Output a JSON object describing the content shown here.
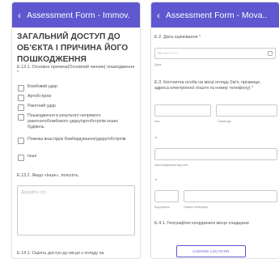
{
  "left_screen": {
    "title": "Assessment Form - Immov.",
    "heading": "ЗАГАЛЬНИЙ ДОСТУП ДО ОБ'ЄКТА І ПРИЧИНА ЙОГО ПОШКОДЖЕННЯ",
    "question_e131": "Е.13.1. Основна причина(Основний чинник) пошкодження *",
    "options": [
      "Бомбовий удар",
      "Артобстріли",
      "Ракетний удар",
      "Пошкодження в результаті непрямого ракетного/бомбового удару/артобстрілів інших будівель",
      "Пожежа внаслідок бомбардування/удару/обстрілів",
      "Інше"
    ],
    "question_e132": "Е.13.2. Якщо «Інше», поясніть.",
    "textarea_placeholder": "Друкуйте тут...",
    "question_e141": "Е.14.1. Оцініть доступ до місця з огляду на"
  },
  "right_screen": {
    "title": "Assessment Form - Mova..",
    "date_label": "Е.2. Дата оцінювання *",
    "date_placeholder": "MM-DD-YYYY",
    "date_caption": "Дата",
    "contact_label": "Е.3. Контактна особа на місці огляду (Ім'я, прізвище, адреса електронної пошти та номер телефону) *",
    "first_name_caption": "Ім'я",
    "last_name_caption": "Прізвище",
    "asterisk_1": "*",
    "email_caption": "приклад@приклад.com",
    "asterisk_2": "*",
    "country_code_caption": "Код країни",
    "phone_caption": "Номер телефону",
    "geo_label": "Е.4.1. Географічні координати місця спадщини",
    "choose_location_button": "CHOOSE LOCATION"
  }
}
